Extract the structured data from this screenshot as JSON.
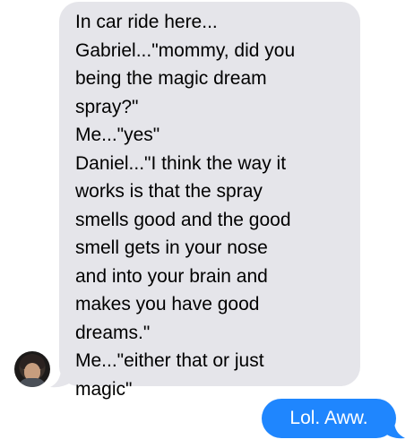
{
  "conversation": {
    "incoming": {
      "avatar_icon": "contact-avatar-photo",
      "bubble_color": "#e5e5ea",
      "lines": [
        "In car ride here...",
        "Gabriel...\"mommy, did you",
        "being the magic dream",
        "spray?\"",
        "Me...\"yes\"",
        "Daniel...\"I think the way it",
        "works is that the spray",
        "smells good and the good",
        "smell gets in your nose",
        "and into your brain and",
        "makes you have good",
        "dreams.\"",
        "Me...\"either that or just",
        "magic\""
      ]
    },
    "outgoing": {
      "bubble_color": "#1f86fe",
      "text": "Lol. Aww."
    }
  }
}
